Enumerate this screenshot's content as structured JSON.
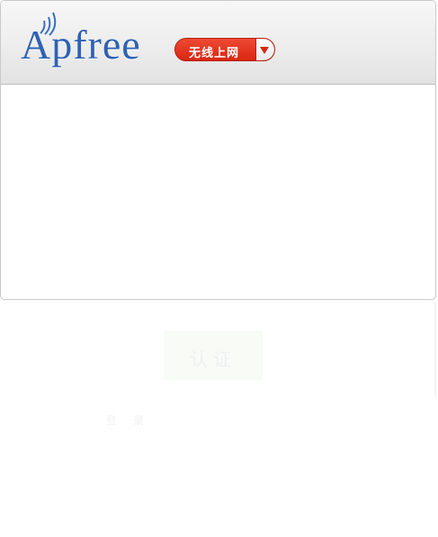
{
  "header": {
    "logo_text": "Apfree",
    "mode_button_label": "无线上网"
  },
  "faded": {
    "button_label": "认证",
    "small_text": "登录"
  },
  "colors": {
    "brand_blue": "#2f62b3",
    "button_red": "#d92612",
    "header_gray": "#ececec"
  },
  "icons": [
    "wifi-signal-icon",
    "dropdown-arrow-icon"
  ]
}
